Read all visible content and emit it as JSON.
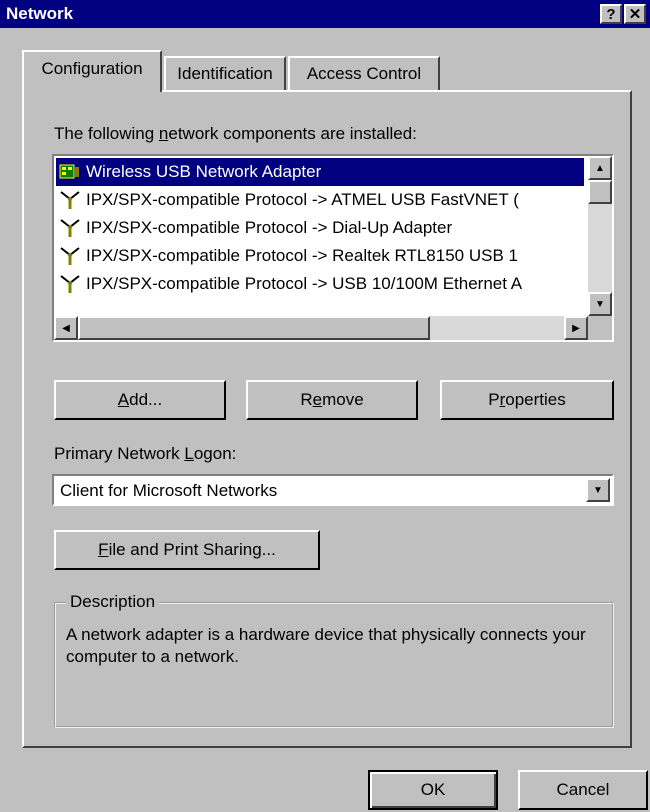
{
  "window": {
    "title": "Network",
    "help_label": "?",
    "close_label": "✕"
  },
  "tabs": [
    {
      "label": "Configuration",
      "active": true
    },
    {
      "label": "Identification",
      "active": false
    },
    {
      "label": "Access Control",
      "active": false
    }
  ],
  "components": {
    "label_before": "The following ",
    "label_mnemonic": "n",
    "label_after": "etwork components are installed:",
    "items": [
      {
        "icon": "network-adapter-icon",
        "text": "Wireless USB Network Adapter",
        "selected": true
      },
      {
        "icon": "protocol-icon",
        "text": "IPX/SPX-compatible Protocol -> ATMEL USB FastVNET (",
        "selected": false
      },
      {
        "icon": "protocol-icon",
        "text": "IPX/SPX-compatible Protocol -> Dial-Up Adapter",
        "selected": false
      },
      {
        "icon": "protocol-icon",
        "text": "IPX/SPX-compatible Protocol -> Realtek RTL8150 USB 1",
        "selected": false
      },
      {
        "icon": "protocol-icon",
        "text": "IPX/SPX-compatible Protocol -> USB 10/100M Ethernet A",
        "selected": false
      }
    ]
  },
  "buttons": {
    "add_mn": "A",
    "add_rest": "dd...",
    "remove_pre": "R",
    "remove_mn": "e",
    "remove_rest": "move",
    "properties_pre": "P",
    "properties_mn": "r",
    "properties_rest": "operties",
    "file_share_mn": "F",
    "file_share_rest": "ile and Print Sharing...",
    "ok": "OK",
    "cancel": "Cancel"
  },
  "logon": {
    "label_before": "Primary Network ",
    "label_mnemonic": "L",
    "label_after": "ogon:",
    "value": "Client for Microsoft Networks"
  },
  "description": {
    "legend": "Description",
    "text": "A network adapter is a hardware device that physically connects your computer to a network."
  },
  "colors": {
    "selection": "#000080",
    "face": "#c0c0c0",
    "titlebar": "#000080"
  }
}
